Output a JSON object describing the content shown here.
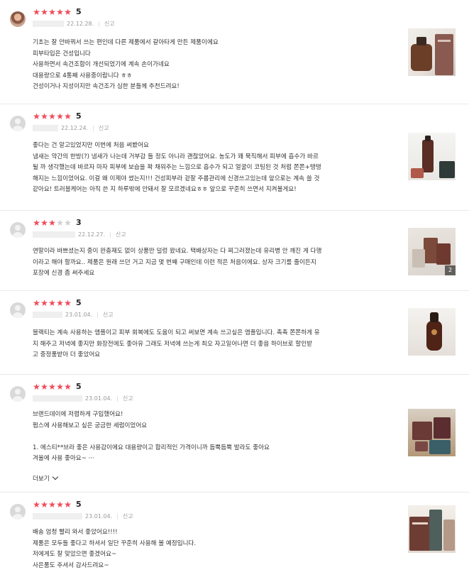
{
  "reviews": [
    {
      "rating": "5",
      "stars_filled": 5,
      "date": "22.12.28.",
      "report_label": "신고",
      "has_photo_avatar": true,
      "lines": [
        "기초는 잘 안바꿔서 쓰는 편인데 다른 제품에서 갈아타게 만든 제품이에요",
        "피부타입은 건성입니다",
        "사용하면서 속건조함이 개선되었기에 계속 손이가네요",
        "대용량으로 4통째 사용중이랍니다 ㅎㅎ",
        "건성이거나 지성이지만 속건조가 심한 분들께 추천드려요!"
      ],
      "more_label": "",
      "photo_count": ""
    },
    {
      "rating": "5",
      "stars_filled": 5,
      "date": "22.12.24.",
      "report_label": "신고",
      "has_photo_avatar": false,
      "lines": [
        "좋다는 건 알고있었지만 이번에 처음 써봤어요",
        "냄새는 약간의 한방(?) 냄새가 나는데 거부감 들 정도 아니라 괜찮았어요. 농도가 꽤 묵직해서 피부에 흡수가 바르",
        "될 까 생각했는데 바르자 마자 피부에 보습을 꽉 채워주는 느낌으로 흡수가 되고 얼굴이 코팅된 것 처럼 쫀쫀+탱탱",
        "해지는 느낌이었어요. 이걸 왜 이제야 썼는지!!! 건성피부라 겉잘 주름관리에 신경쓰고있는데 앞으로는 계속 쓸 것",
        "같아요! 트러블케어는 아직 쓴 지 하루밖에 안돼서 잘 모르겠네요ㅎㅎ 앞으로 꾸준히 쓰면서 지켜볼게요!"
      ],
      "more_label": "",
      "photo_count": ""
    },
    {
      "rating": "3",
      "stars_filled": 3,
      "date": "22.12.27.",
      "report_label": "신고",
      "has_photo_avatar": false,
      "lines": [
        "연말이라 바쁘셨는지 중이 완충재도 없이 상품만 덜렁 왔네요. 택배상자는 다 찌그러졌는데 유리병 안 깨진 게 다행",
        "이라고 해야 할까요.. 제품은 원래 쓰던 거고 지금 몇 번째 구매인데 이런 적은 처음이에요. 상자 크기를 줄이든지",
        "포장에 신경 좀 써주세요"
      ],
      "more_label": "",
      "photo_count": "2"
    },
    {
      "rating": "5",
      "stars_filled": 5,
      "date": "23.01.04.",
      "report_label": "신고",
      "has_photo_avatar": false,
      "lines": [
        "블랙티는 계속 사용하는 앰플이고 피부 회복에도 도움이 되고 써보면 계속 쓰고싶은 앰플입니다. 촉촉 쫀쫀하게 유",
        "지 해주고 저녁에 좋지만 화장전에도 좋아유 그래도 저녁에 쓰는게  최오 자고일어나면 더 좋음 하이브로 할인받",
        "고 중정품받아 더 좋았어요"
      ],
      "more_label": "",
      "photo_count": ""
    },
    {
      "rating": "5",
      "stars_filled": 5,
      "date": "23.01.04.",
      "report_label": "신고",
      "has_photo_avatar": false,
      "lines": [
        "브랜드데이에 저렴하게 구입했어요!",
        "펌스에 사용해보고 싶은 궁금한 세럼이었어요",
        "",
        "1. 에스티**브라 좋은 사용감이에요 대용량이고 합리적인 가격이니까 듬뿍듬뿍 발라도 좋아요",
        "겨울에 사용 좋아요~ ···"
      ],
      "more_label": "더보기",
      "photo_count": ""
    },
    {
      "rating": "5",
      "stars_filled": 5,
      "date": "23.01.04.",
      "report_label": "신고",
      "has_photo_avatar": false,
      "lines": [
        "배송 엄청 빨리 와서 좋았어요!!!!",
        "제품은 모두들 좋다고 하셔서 일단 꾸준히 사용해 볼 예정입니다.",
        "저에게도 잘 맞았으면 좋겠어요~",
        "사은품도 주셔서 감사드려요~"
      ],
      "more_label": "",
      "photo_count": ""
    }
  ]
}
